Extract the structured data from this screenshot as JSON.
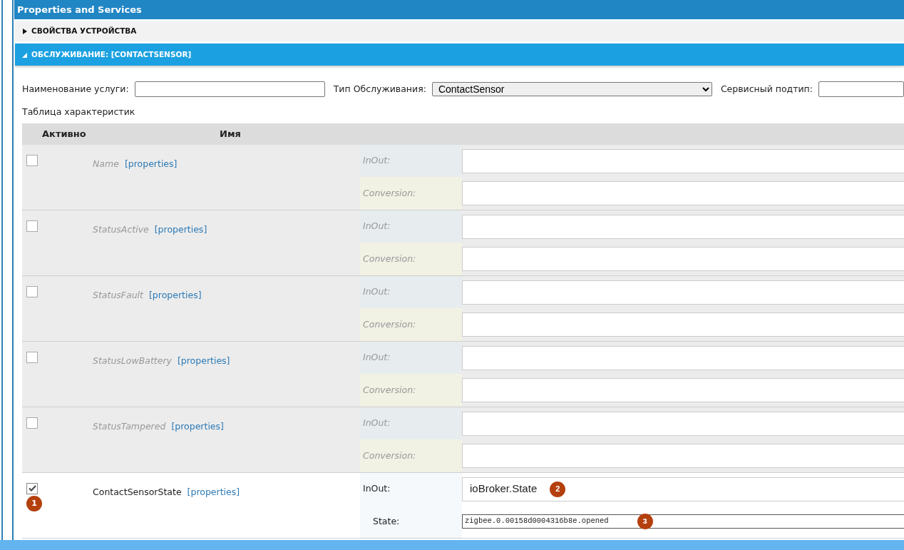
{
  "window": {
    "title": "Properties and Services"
  },
  "sections": [
    {
      "title": "СВОЙСТВА УСТРОЙСТВА",
      "expanded": false
    },
    {
      "title": "ОБСЛУЖИВАНИЕ: [CONTACTSENSOR]",
      "expanded": true
    }
  ],
  "service_form": {
    "name_label": "Наименование услуги:",
    "type_label": "Тип Обслуживания:",
    "type_value": "ContactSensor",
    "subtype_label": "Сервисный подтип:"
  },
  "table": {
    "caption": "Таблица характеристик",
    "columns": [
      "Активно",
      "Имя"
    ],
    "rows": [
      {
        "name": "Name",
        "link": "[properties]",
        "checked": false,
        "fields": [
          {
            "label": "InOut:",
            "kind": "inout"
          },
          {
            "label": "Conversion:",
            "kind": "conversion"
          }
        ]
      },
      {
        "name": "StatusActive",
        "link": "[properties]",
        "checked": false,
        "fields": [
          {
            "label": "InOut:",
            "kind": "inout"
          },
          {
            "label": "Conversion:",
            "kind": "conversion"
          }
        ]
      },
      {
        "name": "StatusFault",
        "link": "[properties]",
        "checked": false,
        "fields": [
          {
            "label": "InOut:",
            "kind": "inout"
          },
          {
            "label": "Conversion:",
            "kind": "conversion"
          }
        ]
      },
      {
        "name": "StatusLowBattery",
        "link": "[properties]",
        "checked": false,
        "fields": [
          {
            "label": "InOut:",
            "kind": "inout"
          },
          {
            "label": "Conversion:",
            "kind": "conversion"
          }
        ]
      },
      {
        "name": "StatusTampered",
        "link": "[properties]",
        "checked": false,
        "fields": [
          {
            "label": "InOut:",
            "kind": "inout"
          },
          {
            "label": "Conversion:",
            "kind": "conversion"
          }
        ]
      },
      {
        "name": "ContactSensorState",
        "link": "[properties]",
        "checked": true,
        "marker": "1",
        "fields": [
          {
            "label": "InOut:",
            "kind": "inout",
            "value": "ioBroker.State",
            "marker": "2"
          },
          {
            "label": "State:",
            "kind": "state",
            "value": "zigbee.0.00158d0004316b8e.opened",
            "marker": "3"
          }
        ]
      }
    ]
  }
}
